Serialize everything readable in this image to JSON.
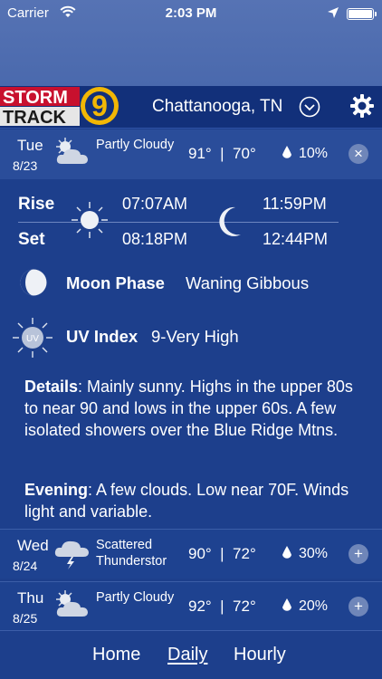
{
  "status_bar": {
    "carrier": "Carrier",
    "time": "2:03 PM",
    "icons": [
      "wifi-icon",
      "location-arrow-icon",
      "battery-icon"
    ]
  },
  "header": {
    "logo_text_line1": "STORM",
    "logo_text_line2": "TRACK",
    "logo_number": "9",
    "location": "Chattanooga, TN",
    "icons": [
      "chevron-down-circle-icon",
      "gear-icon"
    ]
  },
  "days": [
    {
      "dow": "Tue",
      "date": "8/23",
      "condition": "Partly Cloudy",
      "icon": "partly-cloudy-icon",
      "high": "91°",
      "separator": "|",
      "low": "70°",
      "precip": "10%",
      "action": "×",
      "expanded": true
    },
    {
      "dow": "Wed",
      "date": "8/24",
      "condition": "Scattered Thunderstor",
      "icon": "thunderstorm-icon",
      "high": "90°",
      "separator": "|",
      "low": "72°",
      "precip": "30%",
      "action": "+",
      "expanded": false
    },
    {
      "dow": "Thu",
      "date": "8/25",
      "condition": "Partly Cloudy",
      "icon": "partly-cloudy-icon",
      "high": "92°",
      "separator": "|",
      "low": "72°",
      "precip": "20%",
      "action": "+",
      "expanded": false
    }
  ],
  "detail": {
    "rise_label": "Rise",
    "set_label": "Set",
    "sunrise": "07:07AM",
    "sunset": "08:18PM",
    "moonrise": "11:59PM",
    "moonset": "12:44PM",
    "moon_phase_label": "Moon Phase",
    "moon_phase_value": "Waning Gibbous",
    "uv_label": "UV Index",
    "uv_value": "9-Very High",
    "uv_icon_text": "UV",
    "details_label": "Details",
    "details_text": ": Mainly sunny. Highs in the upper 80s to near 90 and lows in the upper 60s.  A few isolated showers over the Blue Ridge Mtns.",
    "evening_label": "Evening",
    "evening_text": ": A few clouds. Low near 70F. Winds light and variable."
  },
  "tabs": [
    {
      "label": "Home",
      "active": false
    },
    {
      "label": "Daily",
      "active": true
    },
    {
      "label": "Hourly",
      "active": false
    }
  ],
  "colors": {
    "background": "#1d3f8c",
    "header": "#12307a",
    "selected_row": "#2a4d9a",
    "button": "#6f86b9",
    "logo_red": "#c8102e",
    "logo_gold": "#f2b705"
  }
}
